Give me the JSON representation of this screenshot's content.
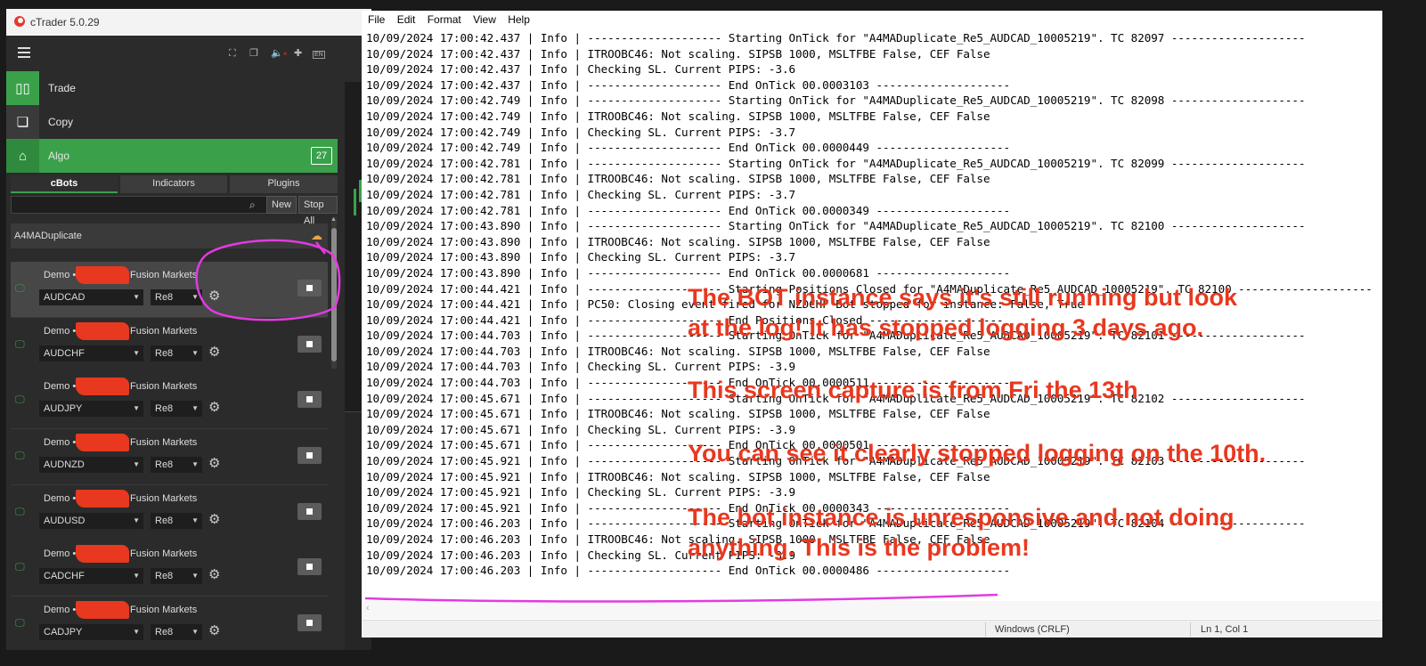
{
  "ctrader": {
    "title": "cTrader 5.0.29",
    "nav": [
      {
        "label": "Trade",
        "icon": "candlestick-icon"
      },
      {
        "label": "Copy",
        "icon": "copy-icon"
      },
      {
        "label": "Algo",
        "icon": "robot-icon",
        "badge": "27"
      }
    ],
    "subtabs": [
      "cBots",
      "Indicators",
      "Plugins"
    ],
    "buttons": {
      "new": "New",
      "stop_all": "Stop All"
    },
    "search_placeholder": "",
    "group_name": "A4MADuplicate",
    "lang_badge": "EN",
    "bots": [
      {
        "account": "Demo •",
        "broker": "Fusion Markets",
        "symbol": "AUDCAD",
        "param": "Re8"
      },
      {
        "account": "Demo •",
        "broker": "Fusion Markets",
        "symbol": "AUDCHF",
        "param": "Re8"
      },
      {
        "account": "Demo •",
        "broker": "Fusion Markets",
        "symbol": "AUDJPY",
        "param": "Re8"
      },
      {
        "account": "Demo •",
        "broker": "Fusion Markets",
        "symbol": "AUDNZD",
        "param": "Re8"
      },
      {
        "account": "Demo •",
        "broker": "Fusion Markets",
        "symbol": "AUDUSD",
        "param": "Re8"
      },
      {
        "account": "Demo •",
        "broker": "Fusion Markets",
        "symbol": "CADCHF",
        "param": "Re8"
      },
      {
        "account": "Demo •",
        "broker": "Fusion Markets",
        "symbol": "CADJPY",
        "param": "Re8"
      }
    ]
  },
  "notepad": {
    "menu": [
      "File",
      "Edit",
      "Format",
      "View",
      "Help"
    ],
    "lines": [
      "10/09/2024 17:00:42.437 | Info | -------------------- Starting OnTick for \"A4MADuplicate_Re5_AUDCAD_10005219\". TC 82097 --------------------",
      "10/09/2024 17:00:42.437 | Info | ITROOBC46: Not scaling. SIPSB 1000, MSLTFBE False, CEF False",
      "10/09/2024 17:00:42.437 | Info | Checking SL. Current PIPS: -3.6",
      "10/09/2024 17:00:42.437 | Info | -------------------- End OnTick 00.0003103 --------------------",
      "10/09/2024 17:00:42.749 | Info | -------------------- Starting OnTick for \"A4MADuplicate_Re5_AUDCAD_10005219\". TC 82098 --------------------",
      "10/09/2024 17:00:42.749 | Info | ITROOBC46: Not scaling. SIPSB 1000, MSLTFBE False, CEF False",
      "10/09/2024 17:00:42.749 | Info | Checking SL. Current PIPS: -3.7",
      "10/09/2024 17:00:42.749 | Info | -------------------- End OnTick 00.0000449 --------------------",
      "10/09/2024 17:00:42.781 | Info | -------------------- Starting OnTick for \"A4MADuplicate_Re5_AUDCAD_10005219\". TC 82099 --------------------",
      "10/09/2024 17:00:42.781 | Info | ITROOBC46: Not scaling. SIPSB 1000, MSLTFBE False, CEF False",
      "10/09/2024 17:00:42.781 | Info | Checking SL. Current PIPS: -3.7",
      "10/09/2024 17:00:42.781 | Info | -------------------- End OnTick 00.0000349 --------------------",
      "10/09/2024 17:00:43.890 | Info | -------------------- Starting OnTick for \"A4MADuplicate_Re5_AUDCAD_10005219\". TC 82100 --------------------",
      "10/09/2024 17:00:43.890 | Info | ITROOBC46: Not scaling. SIPSB 1000, MSLTFBE False, CEF False",
      "10/09/2024 17:00:43.890 | Info | Checking SL. Current PIPS: -3.7",
      "10/09/2024 17:00:43.890 | Info | -------------------- End OnTick 00.0000681 --------------------",
      "10/09/2024 17:00:44.421 | Info | -------------------- Starting Positions Closed for \"A4MADuplicate_Re5_AUDCAD_10005219\". TC 82100 --------------------",
      "10/09/2024 17:00:44.421 | Info | PC50: Closing event fired for NZDCHF Bot stopped for instance: False, True",
      "10/09/2024 17:00:44.421 | Info | -------------------- End Positions Closed --------------------",
      "10/09/2024 17:00:44.703 | Info | -------------------- Starting OnTick for \"A4MADuplicate_Re5_AUDCAD_10005219\". TC 82101 --------------------",
      "10/09/2024 17:00:44.703 | Info | ITROOBC46: Not scaling. SIPSB 1000, MSLTFBE False, CEF False",
      "10/09/2024 17:00:44.703 | Info | Checking SL. Current PIPS: -3.9",
      "10/09/2024 17:00:44.703 | Info | -------------------- End OnTick 00.0000511 --------------------",
      "10/09/2024 17:00:45.671 | Info | -------------------- Starting OnTick for \"A4MADuplicate_Re5_AUDCAD_10005219\". TC 82102 --------------------",
      "10/09/2024 17:00:45.671 | Info | ITROOBC46: Not scaling. SIPSB 1000, MSLTFBE False, CEF False",
      "10/09/2024 17:00:45.671 | Info | Checking SL. Current PIPS: -3.9",
      "10/09/2024 17:00:45.671 | Info | -------------------- End OnTick 00.0000501 --------------------",
      "10/09/2024 17:00:45.921 | Info | -------------------- Starting OnTick for \"A4MADuplicate_Re5_AUDCAD_10005219\". TC 82103 --------------------",
      "10/09/2024 17:00:45.921 | Info | ITROOBC46: Not scaling. SIPSB 1000, MSLTFBE False, CEF False",
      "10/09/2024 17:00:45.921 | Info | Checking SL. Current PIPS: -3.9",
      "10/09/2024 17:00:45.921 | Info | -------------------- End OnTick 00.0000343 --------------------",
      "10/09/2024 17:00:46.203 | Info | -------------------- Starting OnTick for \"A4MADuplicate_Re5_AUDCAD_10005219\". TC 82104 --------------------",
      "10/09/2024 17:00:46.203 | Info | ITROOBC46: Not scaling. SIPSB 1000, MSLTFBE False, CEF False",
      "10/09/2024 17:00:46.203 | Info | Checking SL. Current PIPS: -3.9",
      "10/09/2024 17:00:46.203 | Info | -------------------- End OnTick 00.0000486 --------------------"
    ],
    "status": {
      "encoding": "Windows (CRLF)",
      "position": "Ln 1, Col 1"
    }
  },
  "annotations": [
    "The BOT instance says it's still running but look",
    "at the log! It has stopped logging 3 days ago.",
    "This screen capture is from Fri the 13th",
    "You can see it clearly stopped logging on the 10th.",
    "The bot instance is unresponsive and not doing",
    "anything. This is the problem!"
  ],
  "colors": {
    "accent_green": "#3aa14a",
    "annotation_red": "#e8381f",
    "highlight_magenta": "#e23be0"
  }
}
